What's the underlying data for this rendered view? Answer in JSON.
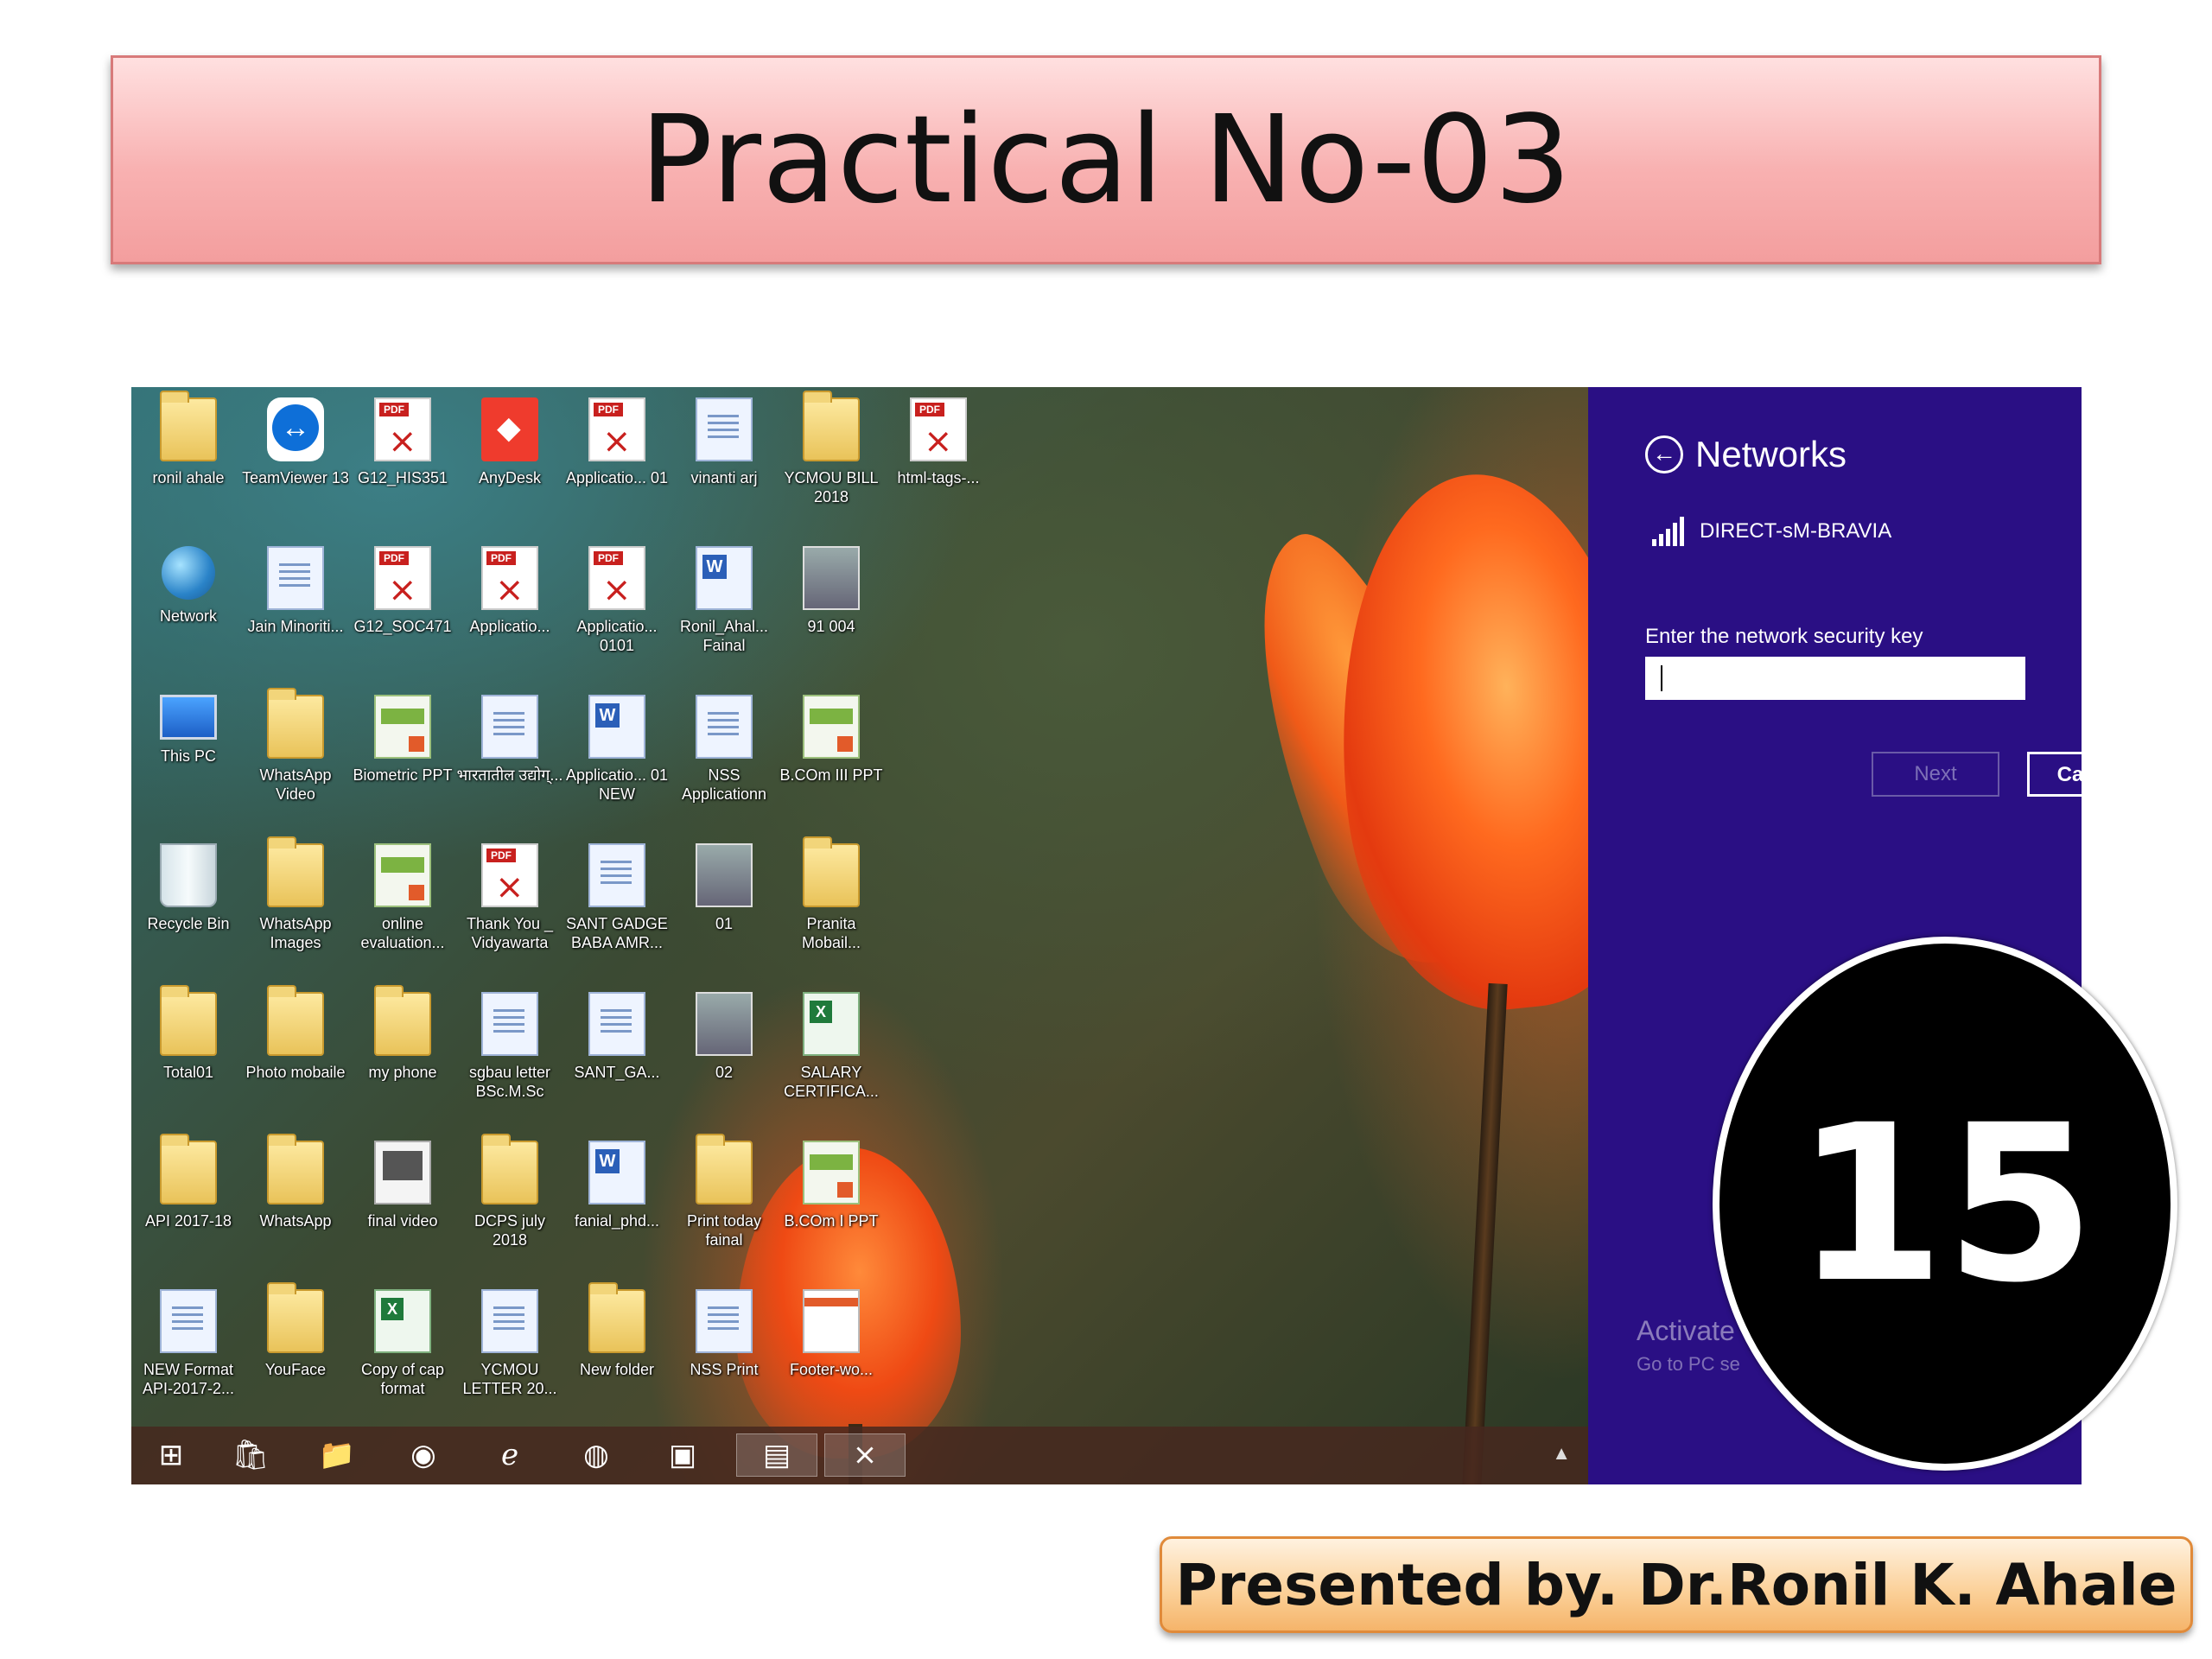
{
  "slide": {
    "title": "Practical No-03",
    "page_number": "15",
    "presenter": "Presented by. Dr.Ronil K. Ahale"
  },
  "desktop": {
    "columns": [
      [
        {
          "label": "ronil ahale",
          "icon": "user-folder-icon"
        },
        {
          "label": "Network",
          "icon": "network-globe-icon"
        },
        {
          "label": "This PC",
          "icon": "computer-monitor-icon"
        },
        {
          "label": "Recycle Bin",
          "icon": "recycle-bin-icon"
        },
        {
          "label": "Total01",
          "icon": "folder-icon"
        },
        {
          "label": "API 2017-18",
          "icon": "folder-icon"
        },
        {
          "label": "NEW Format API-2017-2...",
          "icon": "document-icon"
        }
      ],
      [
        {
          "label": "TeamViewer 13",
          "icon": "teamviewer-icon"
        },
        {
          "label": "Jain Minoriti...",
          "icon": "document-icon"
        },
        {
          "label": "WhatsApp Video",
          "icon": "folder-icon"
        },
        {
          "label": "WhatsApp Images",
          "icon": "folder-icon"
        },
        {
          "label": "Photo mobaile",
          "icon": "folder-icon"
        },
        {
          "label": "WhatsApp",
          "icon": "folder-icon"
        },
        {
          "label": "YouFace",
          "icon": "folder-icon"
        }
      ],
      [
        {
          "label": "G12_HIS351",
          "icon": "pdf-icon"
        },
        {
          "label": "G12_SOC471",
          "icon": "pdf-icon"
        },
        {
          "label": "Biometric PPT",
          "icon": "presentation-icon"
        },
        {
          "label": "online evaluation...",
          "icon": "presentation-icon"
        },
        {
          "label": "my phone",
          "icon": "folder-icon"
        },
        {
          "label": "final video",
          "icon": "avi-video-icon"
        },
        {
          "label": "Copy of cap format",
          "icon": "excel-icon"
        }
      ],
      [
        {
          "label": "AnyDesk",
          "icon": "anydesk-icon"
        },
        {
          "label": "Applicatio...",
          "icon": "pdf-icon"
        },
        {
          "label": "भारतातील उद्योग्...",
          "icon": "document-icon"
        },
        {
          "label": "Thank You _ Vidyawarta",
          "icon": "pdf-icon"
        },
        {
          "label": "sgbau letter BSc.M.Sc",
          "icon": "document-icon"
        },
        {
          "label": "DCPS july 2018",
          "icon": "folder-icon"
        },
        {
          "label": "YCMOU LETTER 20...",
          "icon": "document-icon"
        }
      ],
      [
        {
          "label": "Applicatio... 01",
          "icon": "pdf-icon"
        },
        {
          "label": "Applicatio... 0101",
          "icon": "pdf-icon"
        },
        {
          "label": "Applicatio... 01 NEW",
          "icon": "word-icon"
        },
        {
          "label": "SANT GADGE BABA AMR...",
          "icon": "document-icon"
        },
        {
          "label": "SANT_GA...",
          "icon": "document-icon"
        },
        {
          "label": "fanial_phd...",
          "icon": "word-icon"
        },
        {
          "label": "New folder",
          "icon": "folder-icon"
        }
      ],
      [
        {
          "label": "vinanti arj",
          "icon": "document-icon"
        },
        {
          "label": "Ronil_Ahal... Fainal",
          "icon": "word-icon"
        },
        {
          "label": "NSS Applicationn",
          "icon": "document-icon"
        },
        {
          "label": "01",
          "icon": "image-icon"
        },
        {
          "label": "02",
          "icon": "image-icon"
        },
        {
          "label": "Print today fainal",
          "icon": "folder-icon"
        },
        {
          "label": "NSS Print",
          "icon": "document-icon"
        }
      ],
      [
        {
          "label": "YCMOU BILL 2018",
          "icon": "folder-icon"
        },
        {
          "label": "91 004",
          "icon": "image-icon"
        },
        {
          "label": "B.COm III PPT",
          "icon": "presentation-icon"
        },
        {
          "label": "Pranita Mobail...",
          "icon": "folder-icon"
        },
        {
          "label": "SALARY CERTIFICA...",
          "icon": "excel-icon"
        },
        {
          "label": "B.COm I PPT",
          "icon": "presentation-icon"
        },
        {
          "label": "Footer-wo...",
          "icon": "footer-doc-icon"
        }
      ],
      [
        {
          "label": "html-tags-...",
          "icon": "pdf-icon"
        }
      ]
    ],
    "taskbar": [
      {
        "name": "windows-start-icon",
        "glyph": "⊞"
      },
      {
        "name": "store-icon",
        "glyph": "🛍"
      },
      {
        "name": "file-explorer-icon",
        "glyph": "📁"
      },
      {
        "name": "chrome-icon",
        "glyph": "◉"
      },
      {
        "name": "internet-explorer-icon",
        "glyph": "ℯ"
      },
      {
        "name": "firefox-icon",
        "glyph": "◍"
      },
      {
        "name": "photos-icon",
        "glyph": "▣"
      },
      {
        "name": "powerpoint-icon",
        "glyph": "▤"
      },
      {
        "name": "acrobat-icon",
        "glyph": "⨯"
      }
    ]
  },
  "networks_panel": {
    "title": "Networks",
    "network_name": "DIRECT-sM-BRAVIA",
    "key_label": "Enter the network security key",
    "key_value": "",
    "next_label": "Next",
    "cancel_label": "Cancel",
    "activate_text": "Activate",
    "activate_sub": "Go to PC se"
  },
  "colors": {
    "charm_background": "#2a0f84",
    "title_banner": "#f8b1b1",
    "presenter_banner": "#fbcf96",
    "badge": "#000000"
  }
}
